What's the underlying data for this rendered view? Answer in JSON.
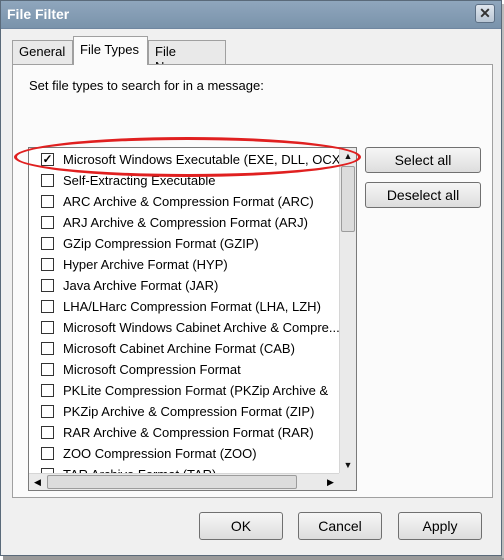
{
  "window": {
    "title": "File Filter",
    "close_glyph": "✕"
  },
  "tabs": [
    {
      "label": "General",
      "active": false
    },
    {
      "label": "File Types",
      "active": true
    },
    {
      "label": "File Names",
      "active": false
    }
  ],
  "panel": {
    "instruction": "Set file types to search for in a message:",
    "file_types": [
      {
        "label": "Microsoft Windows Executable (EXE, DLL, OCX)",
        "checked": true
      },
      {
        "label": "Self-Extracting Executable",
        "checked": false
      },
      {
        "label": "ARC Archive & Compression Format (ARC)",
        "checked": false
      },
      {
        "label": "ARJ Archive & Compression Format (ARJ)",
        "checked": false
      },
      {
        "label": "GZip Compression Format (GZIP)",
        "checked": false
      },
      {
        "label": "Hyper Archive Format (HYP)",
        "checked": false
      },
      {
        "label": "Java Archive Format (JAR)",
        "checked": false
      },
      {
        "label": "LHA/LHarc Compression Format (LHA, LZH)",
        "checked": false
      },
      {
        "label": "Microsoft Windows Cabinet Archive & Compre...",
        "checked": false
      },
      {
        "label": "Microsoft Cabinet Archine Format (CAB)",
        "checked": false
      },
      {
        "label": "Microsoft Compression Format",
        "checked": false
      },
      {
        "label": "PKLite Compression Format     (PKZip Archive &",
        "checked": false
      },
      {
        "label": "PKZip Archive & Compression Format (ZIP)",
        "checked": false
      },
      {
        "label": "RAR Archive & Compression Format (RAR)",
        "checked": false
      },
      {
        "label": "ZOO Compression Format (ZOO)",
        "checked": false
      },
      {
        "label": "TAR Archive Format (TAR)",
        "checked": false
      }
    ],
    "select_all_label": "Select all",
    "deselect_all_label": "Deselect all"
  },
  "footer": {
    "ok_label": "OK",
    "cancel_label": "Cancel",
    "apply_label": "Apply"
  },
  "colors": {
    "highlight": "#e02020",
    "titlebar": "#8fa6bd"
  }
}
